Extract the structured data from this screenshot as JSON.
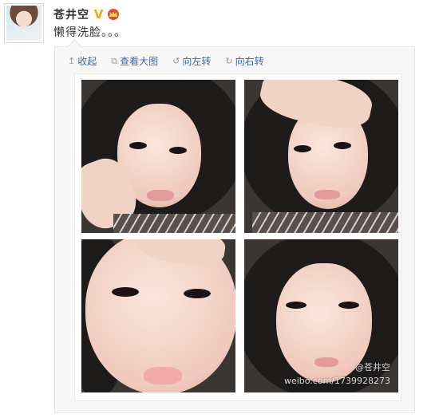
{
  "user": {
    "name": "苍井空"
  },
  "post": {
    "text": "懒得洗脸。。。"
  },
  "toolbar": {
    "items": [
      {
        "icon": "up-arrow-icon",
        "label": "收起"
      },
      {
        "icon": "external-link-icon",
        "label": "查看大图"
      },
      {
        "icon": "rotate-left-icon",
        "label": "向左转"
      },
      {
        "icon": "rotate-right-icon",
        "label": "向右转"
      }
    ]
  },
  "photo": {
    "watermark_handle": "@苍井空",
    "watermark_url": "weibo.com/1739928273"
  },
  "colors": {
    "link": "#3b6aa8",
    "badge_v": "#f4a21f",
    "badge_crown": "#e5463c"
  }
}
